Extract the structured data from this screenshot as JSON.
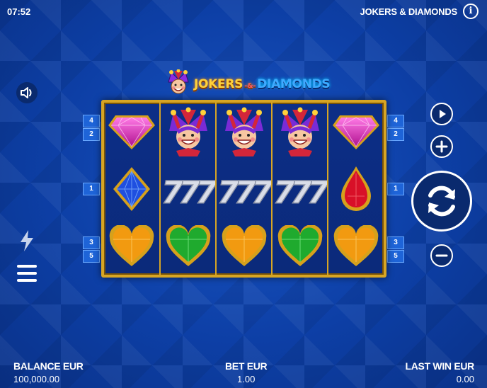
{
  "status_bar": {
    "time": "07:52",
    "game_title": "JOKERS & DIAMONDS",
    "info_icon": "info-icon"
  },
  "logo": {
    "part1": "JOKERS",
    "amp": "-&-",
    "part2": "DIAMONDS"
  },
  "reels": {
    "columns": [
      [
        "pink-diamond",
        "blue-diamond",
        "orange-heart"
      ],
      [
        "jester",
        "seven-seven-seven",
        "green-heart"
      ],
      [
        "jester",
        "seven-seven-seven",
        "orange-heart"
      ],
      [
        "jester",
        "seven-seven-seven",
        "green-heart"
      ],
      [
        "pink-diamond",
        "red-drop",
        "orange-heart"
      ]
    ]
  },
  "paylines": {
    "left": [
      "4",
      "2",
      "1",
      "3",
      "5"
    ],
    "right": [
      "4",
      "2",
      "1",
      "3",
      "5"
    ]
  },
  "colors": {
    "background": "#0d3fa6",
    "frame_gold": "#d7a524",
    "line_marker": "#1e64d8"
  },
  "controls": {
    "sound_icon": "speaker-icon",
    "turbo_icon": "lightning-icon",
    "menu_icon": "hamburger-menu-icon",
    "autoplay_icon": "play-icon",
    "bet_increase_icon": "plus-icon",
    "spin_icon": "spin-arrows-icon",
    "bet_decrease_icon": "minus-icon"
  },
  "footer": {
    "balance_label": "BALANCE EUR",
    "balance_value": "100,000.00",
    "bet_label": "BET EUR",
    "bet_value": "1.00",
    "last_win_label": "LAST WIN EUR",
    "last_win_value": "0.00"
  }
}
